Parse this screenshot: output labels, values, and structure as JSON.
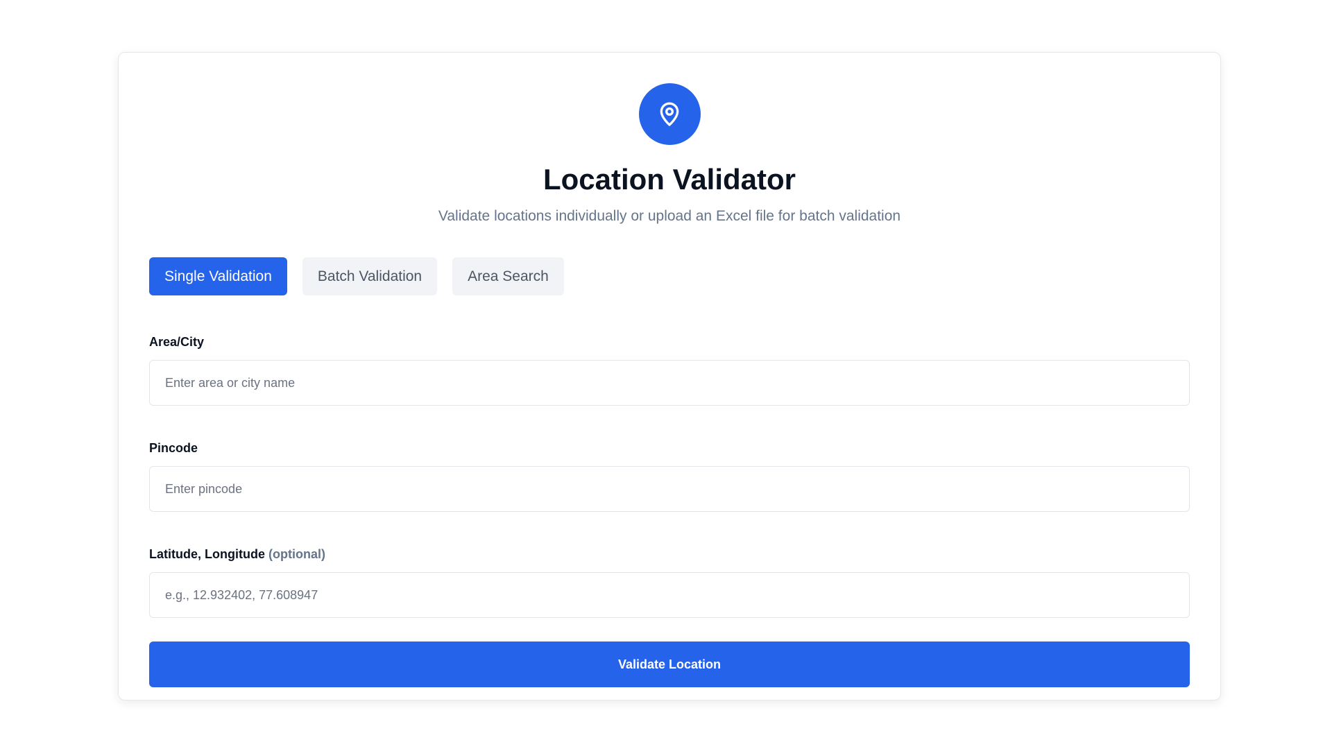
{
  "header": {
    "icon": "location-pin-icon",
    "title": "Location Validator",
    "subtitle": "Validate locations individually or upload an Excel file for batch validation"
  },
  "tabs": [
    {
      "label": "Single Validation",
      "active": true
    },
    {
      "label": "Batch Validation",
      "active": false
    },
    {
      "label": "Area Search",
      "active": false
    }
  ],
  "form": {
    "area": {
      "label": "Area/City",
      "placeholder": "Enter area or city name",
      "value": ""
    },
    "pincode": {
      "label": "Pincode",
      "placeholder": "Enter pincode",
      "value": ""
    },
    "coords": {
      "label": "Latitude, Longitude",
      "optional": "(optional)",
      "placeholder": "e.g., 12.932402, 77.608947",
      "value": ""
    },
    "submit_label": "Validate Location"
  },
  "colors": {
    "accent": "#2563eb",
    "tab_inactive_bg": "#f1f3f6",
    "title": "#0b1220",
    "muted": "#64748b"
  }
}
